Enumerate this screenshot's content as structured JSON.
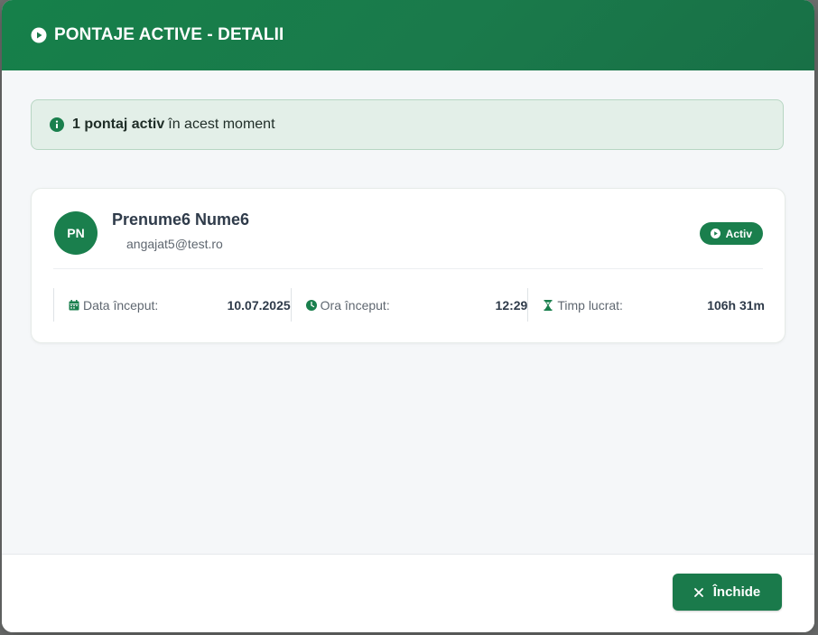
{
  "modal": {
    "title": "PONTAJE ACTIVE - DETALII",
    "accent_color": "#1a7a4b"
  },
  "alert": {
    "count_bold": "1 pontaj activ",
    "text": "în acest moment"
  },
  "employee": {
    "initials": "PN",
    "name": "Prenume6 Nume6",
    "email": "angajat5@test.ro",
    "status": "Activ"
  },
  "stats": [
    {
      "label": "Data început:",
      "value": "10.07.2025",
      "icon": "calendar-icon"
    },
    {
      "label": "Ora început:",
      "value": "12:29",
      "icon": "clock-icon"
    },
    {
      "label": "Timp lucrat:",
      "value": "106h 31m",
      "icon": "hourglass-icon"
    }
  ],
  "footer": {
    "close_label": "Închide"
  }
}
